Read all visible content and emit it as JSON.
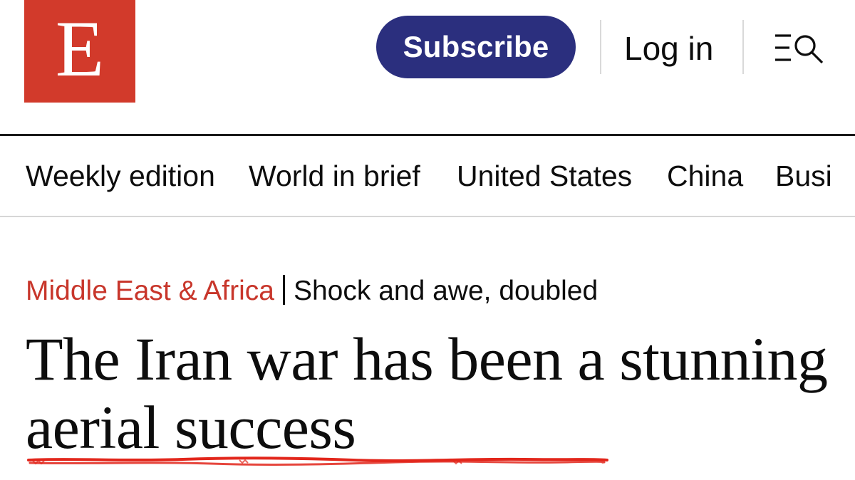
{
  "header": {
    "logo_letter": "E",
    "subscribe_label": "Subscribe",
    "login_label": "Log in",
    "menu_icon": "menu-search-icon"
  },
  "nav": {
    "items": [
      "Weekly edition",
      "World in brief",
      "United States",
      "China",
      "Busi"
    ]
  },
  "article": {
    "section": "Middle East & Africa",
    "flytitle": "Shock and awe, doubled",
    "headline": "The Iran war has been a stunning aerial success"
  },
  "colors": {
    "brand_red": "#d23a2b",
    "subscribe_navy": "#2b2f7e",
    "section_red": "#c8362b",
    "annotation_red": "#e2261b"
  }
}
